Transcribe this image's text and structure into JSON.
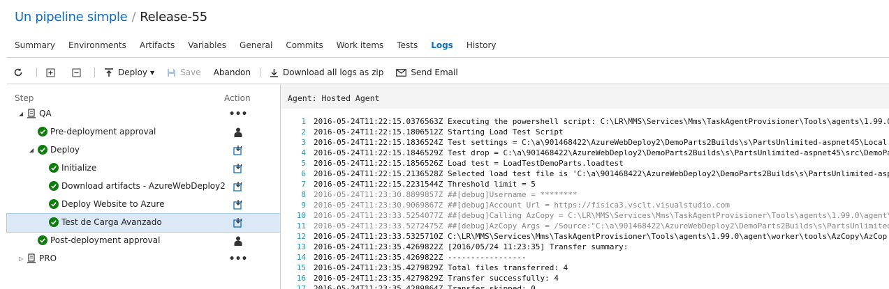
{
  "breadcrumb": {
    "pipeline": "Un pipeline simple",
    "separator": "/",
    "release": "Release-55"
  },
  "tabs": [
    "Summary",
    "Environments",
    "Artifacts",
    "Variables",
    "General",
    "Commits",
    "Work items",
    "Tests",
    "Logs",
    "History"
  ],
  "active_tab": "Logs",
  "toolbar": {
    "deploy": "Deploy",
    "save": "Save",
    "abandon": "Abandon",
    "download_logs": "Download all logs as zip",
    "send_email": "Send Email"
  },
  "tree": {
    "header_step": "Step",
    "header_action": "Action",
    "rows": [
      {
        "label": "QA",
        "icon": "server-icon",
        "action": "more",
        "expanded": true
      },
      {
        "label": "Pre-deployment approval",
        "icon": "success-icon",
        "action": "person"
      },
      {
        "label": "Deploy",
        "icon": "success-icon",
        "action": "download",
        "expanded": true
      },
      {
        "label": "Initialize",
        "icon": "success-icon",
        "action": "download"
      },
      {
        "label": "Download artifacts - AzureWebDeploy2",
        "icon": "success-icon",
        "action": "download"
      },
      {
        "label": "Deploy Website to Azure",
        "icon": "success-icon",
        "action": "download"
      },
      {
        "label": "Test de Carga Avanzado",
        "icon": "success-icon",
        "action": "download",
        "selected": true
      },
      {
        "label": "Post-deployment approval",
        "icon": "success-icon",
        "action": "person"
      },
      {
        "label": "PRO",
        "icon": "server-icon",
        "action": "more",
        "expanded": false
      }
    ]
  },
  "log": {
    "agent": "Agent: Hosted Agent",
    "lines": [
      {
        "no": "1",
        "text": "2016-05-24T11:22:15.0376563Z Executing the powershell script: C:\\LR\\MMS\\Services\\Mms\\TaskAgentProvisioner\\Tools\\agents\\1.99.0"
      },
      {
        "no": "2",
        "text": "2016-05-24T11:22:15.1806512Z Starting Load Test Script"
      },
      {
        "no": "3",
        "text": "2016-05-24T11:22:15.1836524Z Test settings = C:\\a\\901468422\\AzureWebDeploy2\\DemoParts2Builds\\s\\PartsUnlimited-aspnet45\\Local."
      },
      {
        "no": "4",
        "text": "2016-05-24T11:22:15.1846529Z Test drop = C:\\a\\901468422\\AzureWebDeploy2\\DemoParts2Builds\\s\\PartsUnlimited-aspnet45\\src\\DemoPa"
      },
      {
        "no": "5",
        "text": "2016-05-24T11:22:15.1856526Z Load test = LoadTestDemoParts.loadtest"
      },
      {
        "no": "6",
        "text": "2016-05-24T11:22:15.2136528Z Selected load test file is 'C:\\a\\901468422\\AzureWebDeploy2\\DemoParts2Builds\\s\\PartsUnlimited-asp"
      },
      {
        "no": "7",
        "text": "2016-05-24T11:22:15.2231544Z Threshold limit = 5"
      },
      {
        "no": "8",
        "text": "2016-05-24T11:23:30.8899857Z ##[debug]Username = ********",
        "debug": true
      },
      {
        "no": "9",
        "text": "2016-05-24T11:23:30.9069867Z ##[debug]Account Url = https://fisica3.vsclt.visualstudio.com",
        "debug": true
      },
      {
        "no": "10",
        "text": "2016-05-24T11:23:33.5254077Z ##[debug]Calling AzCopy = C:\\LR\\MMS\\Services\\Mms\\TaskAgentProvisioner\\Tools\\agents\\1.99.0\\agent\\",
        "debug": true
      },
      {
        "no": "11",
        "text": "2016-05-24T11:23:33.5272475Z ##[debug]AzCopy Args = /Source:\"C:\\a\\901468422\\AzureWebDeploy2\\DemoParts2Builds\\s\\PartsUnlimited",
        "debug": true
      },
      {
        "no": "12",
        "text": "2016-05-24T11:23:33.5325710Z C:\\LR\\MMS\\Services\\Mms\\TaskAgentProvisioner\\Tools\\agents\\1.99.0\\agent\\worker\\tools\\AzCopy\\AzCop"
      },
      {
        "no": "13",
        "text": "2016-05-24T11:23:35.4269822Z [2016/05/24 11:23:35] Transfer summary:"
      },
      {
        "no": "14",
        "text": "2016-05-24T11:23:35.4269822Z -----------------"
      },
      {
        "no": "15",
        "text": "2016-05-24T11:23:35.4279829Z Total files transferred: 4"
      },
      {
        "no": "16",
        "text": "2016-05-24T11:23:35.4279829Z Transfer successfully:   4"
      },
      {
        "no": "17",
        "text": "2016-05-24T11:23:35.4289864Z Transfer skipped:        0"
      }
    ]
  },
  "colors": {
    "accent": "#106ebe",
    "success": "#107c10",
    "selection": "#dbe9f7",
    "line_number": "#2b91af"
  }
}
